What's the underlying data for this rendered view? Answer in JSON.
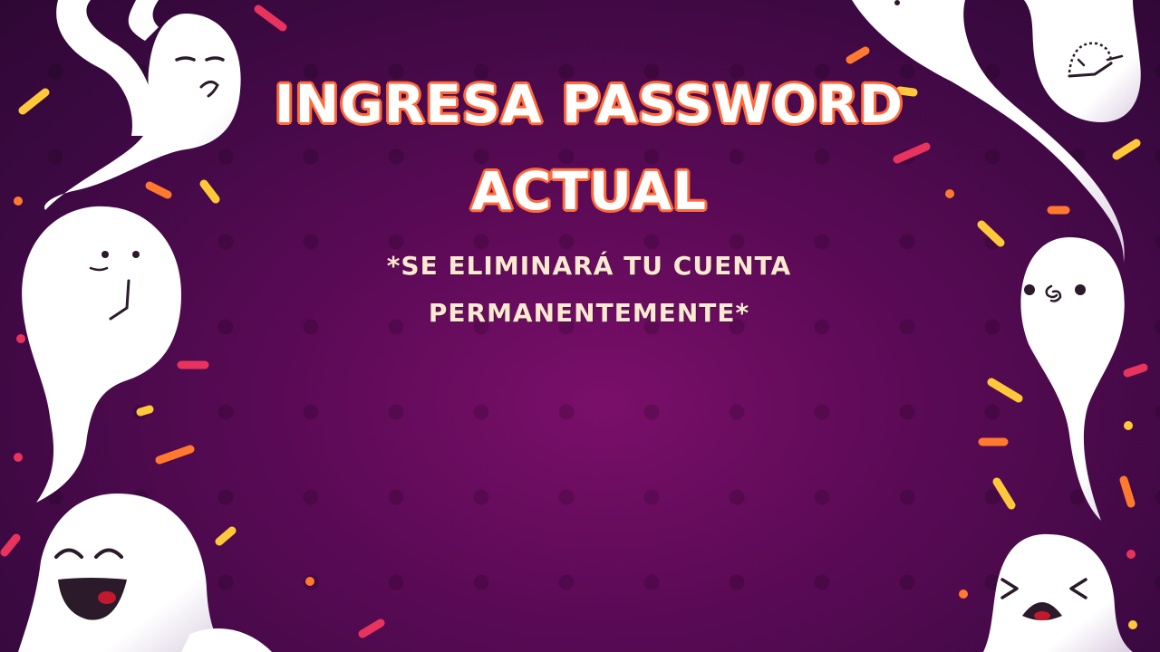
{
  "slide": {
    "title_line1": "INGRESA PASSWORD",
    "title_line2": "ACTUAL",
    "subtitle_line1": "*SE ELIMINARÁ TU CUENTA",
    "subtitle_line2": "PERMANENTEMENTE*"
  },
  "colors": {
    "background": "#5a0a55",
    "title_fill": "#ffffff",
    "title_outline": "#ff6a3a",
    "subtitle": "#ffe9d2",
    "ghost": "#ffffff",
    "ghost_shade": "#cdbcd6",
    "confetti_yellow": "#ffc83a",
    "confetti_orange": "#ff7a2e",
    "confetti_pink": "#e8335e"
  },
  "decor": {
    "ghost_icons": [
      "annoyed-ghost-icon",
      "smirk-ghost-icon",
      "laughing-ghost-icon",
      "peeking-ghost-icon",
      "surprised-ghost-icon",
      "crying-ghost-icon"
    ],
    "confetti_icon": "confetti-icon"
  }
}
